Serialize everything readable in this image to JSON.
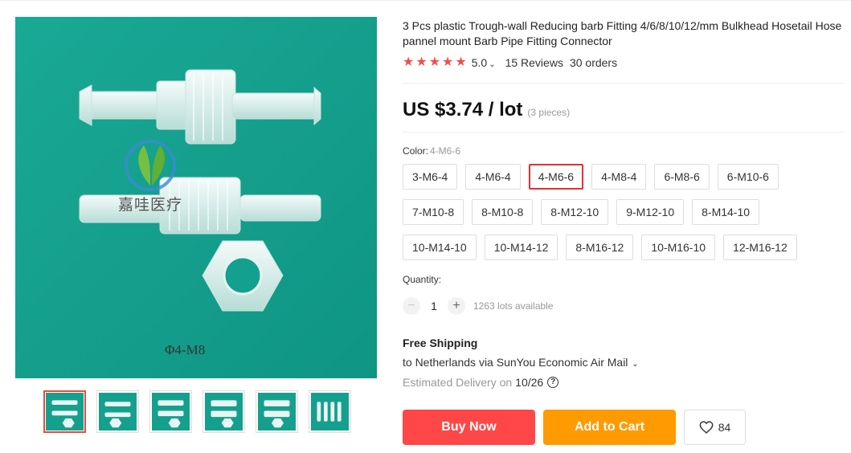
{
  "product": {
    "title": "3 Pcs plastic Trough-wall Reducing barb Fitting 4/6/8/10/12/mm Bulkhead Hosetail Hose pannel mount Barb Pipe Fitting Connector",
    "image_watermark": "嘉哇医疗",
    "image_caption": "Φ4-M8"
  },
  "rating": {
    "stars": 5,
    "value": "5.0",
    "reviews": "15 Reviews",
    "orders": "30 orders",
    "star_color": "#f04f4f"
  },
  "price": {
    "value": "US $3.74 / lot",
    "pieces": "(3 pieces)"
  },
  "sku": {
    "label": "Color:",
    "selected": "4-M6-6",
    "rows": [
      [
        "3-M6-4",
        "4-M6-4",
        "4-M6-6",
        "4-M8-4",
        "6-M8-6",
        "6-M10-6"
      ],
      [
        "7-M10-8",
        "8-M10-8",
        "8-M12-10",
        "9-M12-10",
        "8-M14-10"
      ],
      [
        "10-M14-10",
        "10-M14-12",
        "8-M16-12",
        "10-M16-10",
        "12-M16-12"
      ]
    ],
    "active_color": "#e62e2e"
  },
  "quantity": {
    "label": "Quantity:",
    "value": "1",
    "minus": "−",
    "plus": "+",
    "available": "1263 lots available"
  },
  "shipping": {
    "title": "Free Shipping",
    "to": "to Netherlands via SunYou Economic Air Mail",
    "estimated_label": "Estimated Delivery on",
    "estimated_date": "10/26"
  },
  "actions": {
    "buy_now": "Buy Now",
    "add_to_cart": "Add to Cart",
    "wishlist_count": "84",
    "buy_color": "#ff4747",
    "cart_color": "#ff9a00"
  },
  "icons": [
    "star-icon",
    "chevron-down-icon",
    "help-icon",
    "heart-icon"
  ],
  "gallery": {
    "thumb_count": 6,
    "active_index": 0,
    "background": "#14a08e"
  }
}
